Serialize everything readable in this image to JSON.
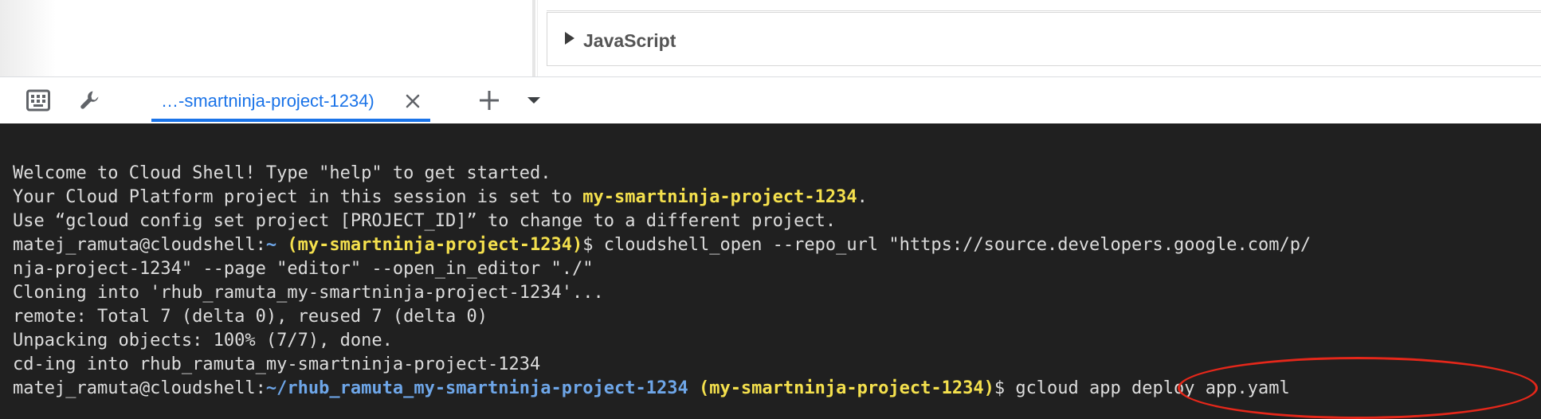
{
  "editor": {
    "panel_title": "JavaScript"
  },
  "tabbar": {
    "tabs": [
      {
        "label": "…-smartninja-project-1234)",
        "active": true
      }
    ],
    "icons": [
      "keyboard-icon",
      "wrench-icon",
      "close-icon",
      "plus-icon",
      "caret-down-icon"
    ]
  },
  "terminal": {
    "lines": [
      {
        "segments": [
          {
            "text": "Welcome to Cloud Shell! Type \"help\" to get started."
          }
        ]
      },
      {
        "segments": [
          {
            "text": "Your Cloud Platform project in this session is set to "
          },
          {
            "text": "my-smartninja-project-1234",
            "style": "yellow"
          },
          {
            "text": "."
          }
        ]
      },
      {
        "segments": [
          {
            "text": "Use “gcloud config set project [PROJECT_ID]” to change to a different project."
          }
        ]
      },
      {
        "segments": [
          {
            "text": "matej_ramuta@cloudshell:"
          },
          {
            "text": "~",
            "style": "blue"
          },
          {
            "text": " "
          },
          {
            "text": "(my-smartninja-project-1234)",
            "style": "yellow"
          },
          {
            "text": "$ cloudshell_open --repo_url \"https://source.developers.google.com/p/"
          }
        ]
      },
      {
        "segments": [
          {
            "text": "nja-project-1234\" --page \"editor\" --open_in_editor \"./\""
          }
        ]
      },
      {
        "segments": [
          {
            "text": "Cloning into 'rhub_ramuta_my-smartninja-project-1234'..."
          }
        ]
      },
      {
        "segments": [
          {
            "text": "remote: Total 7 (delta 0), reused 7 (delta 0)"
          }
        ]
      },
      {
        "segments": [
          {
            "text": "Unpacking objects: 100% (7/7), done."
          }
        ]
      },
      {
        "segments": [
          {
            "text": "cd-ing into rhub_ramuta_my-smartninja-project-1234"
          }
        ]
      },
      {
        "segments": [
          {
            "text": "matej_ramuta@cloudshell:"
          },
          {
            "text": "~/rhub_ramuta_my-smartninja-project-1234",
            "style": "blue"
          },
          {
            "text": " "
          },
          {
            "text": "(my-smartninja-project-1234)",
            "style": "yellow"
          },
          {
            "text": "$ gcloud app deploy app.yaml"
          }
        ]
      }
    ]
  },
  "colors": {
    "terminal_bg": "#202020",
    "terminal_fg": "#dcdcdc",
    "prompt_project": "#f4e04d",
    "prompt_path": "#6ea6e8",
    "tab_accent": "#1a73e8",
    "annotation": "#e5271a"
  }
}
